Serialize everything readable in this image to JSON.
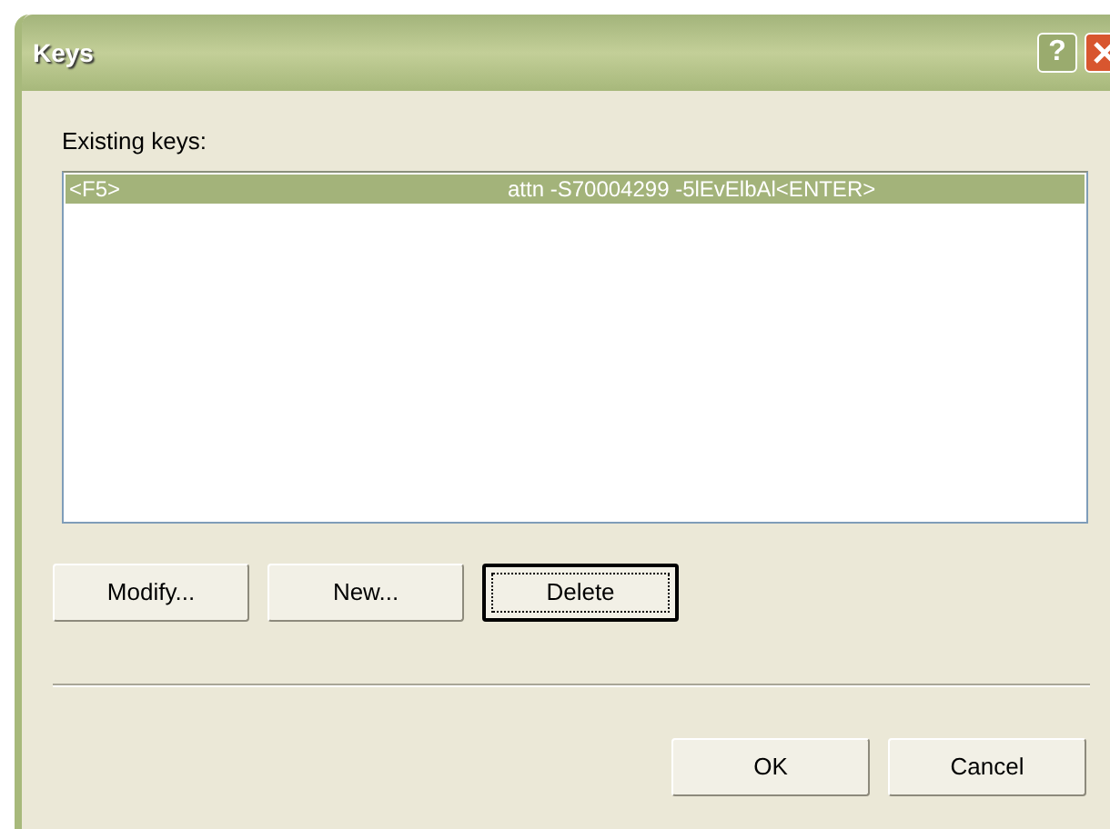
{
  "window": {
    "title": "Keys",
    "title_buttons": [
      {
        "kind": "help",
        "label": "?"
      },
      {
        "kind": "close"
      }
    ]
  },
  "list_label": "Existing keys:",
  "keys": [
    {
      "key": "<F5>",
      "value": "attn -S70004299 -5lEvElbAl<ENTER>",
      "selected": true
    }
  ],
  "buttons": [
    {
      "label": "Modify...",
      "focused": false
    },
    {
      "label": "New...",
      "focused": false
    },
    {
      "label": "Delete",
      "focused": true
    }
  ],
  "footer_buttons": [
    "OK",
    "Cancel"
  ]
}
